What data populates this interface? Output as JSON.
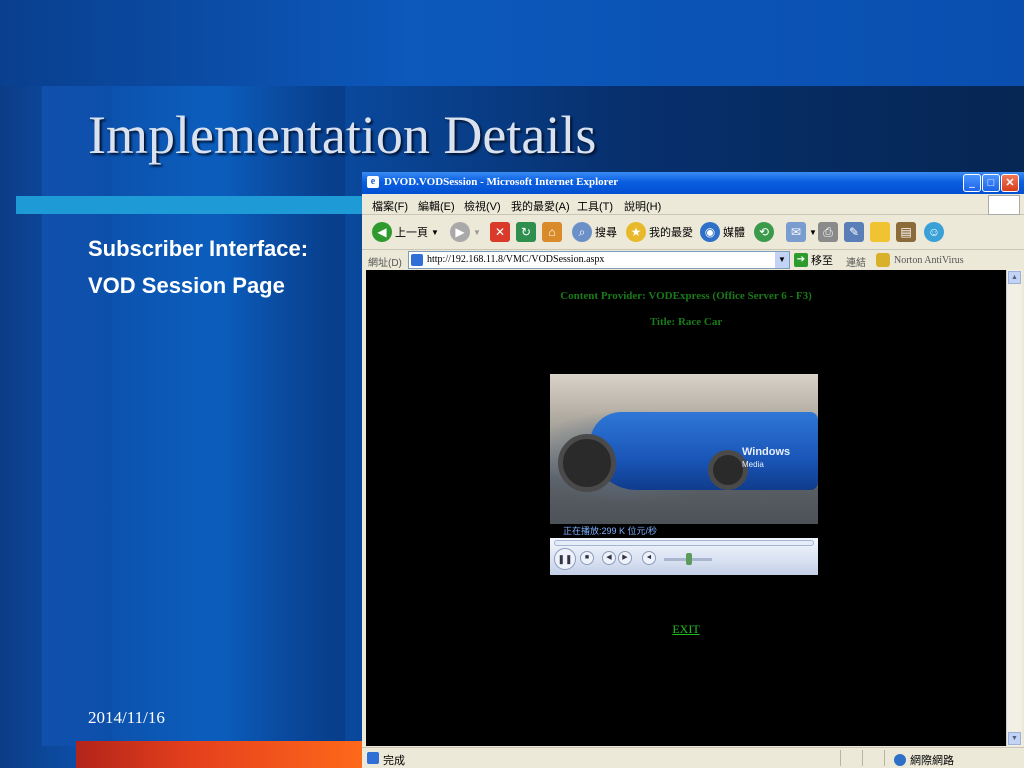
{
  "slide": {
    "title": "Implementation Details",
    "subtitle_line1": "Subscriber Interface:",
    "subtitle_line2": "VOD Session Page",
    "date": "2014/11/16"
  },
  "browser": {
    "title": "DVOD.VODSession - Microsoft Internet Explorer",
    "menu": [
      "檔案(F)",
      "編輯(E)",
      "檢視(V)",
      "我的最愛(A)",
      "工具(T)",
      "說明(H)"
    ],
    "toolbar": {
      "back": "上一頁",
      "search": "搜尋",
      "favorites": "我的最愛",
      "media": "媒體"
    },
    "address_label": "網址(D)",
    "url": "http://192.168.11.8/VMC/VODSession.aspx",
    "go": "移至",
    "links": "連結",
    "norton": "Norton AntiVirus",
    "status_text": "完成",
    "zone": "網際網路"
  },
  "page": {
    "provider_line": "Content Provider: VODExpress (Office Server 6 - F3)",
    "title_line": "Title: Race Car",
    "player_status": "正在播放:299 K 位元/秒",
    "exit": "EXIT"
  },
  "colors": {
    "ie_title_blue": "#0a5ee0",
    "page_bg": "#000000",
    "provider_text": "#1a7a1a",
    "exit_link": "#1fbf1f"
  }
}
